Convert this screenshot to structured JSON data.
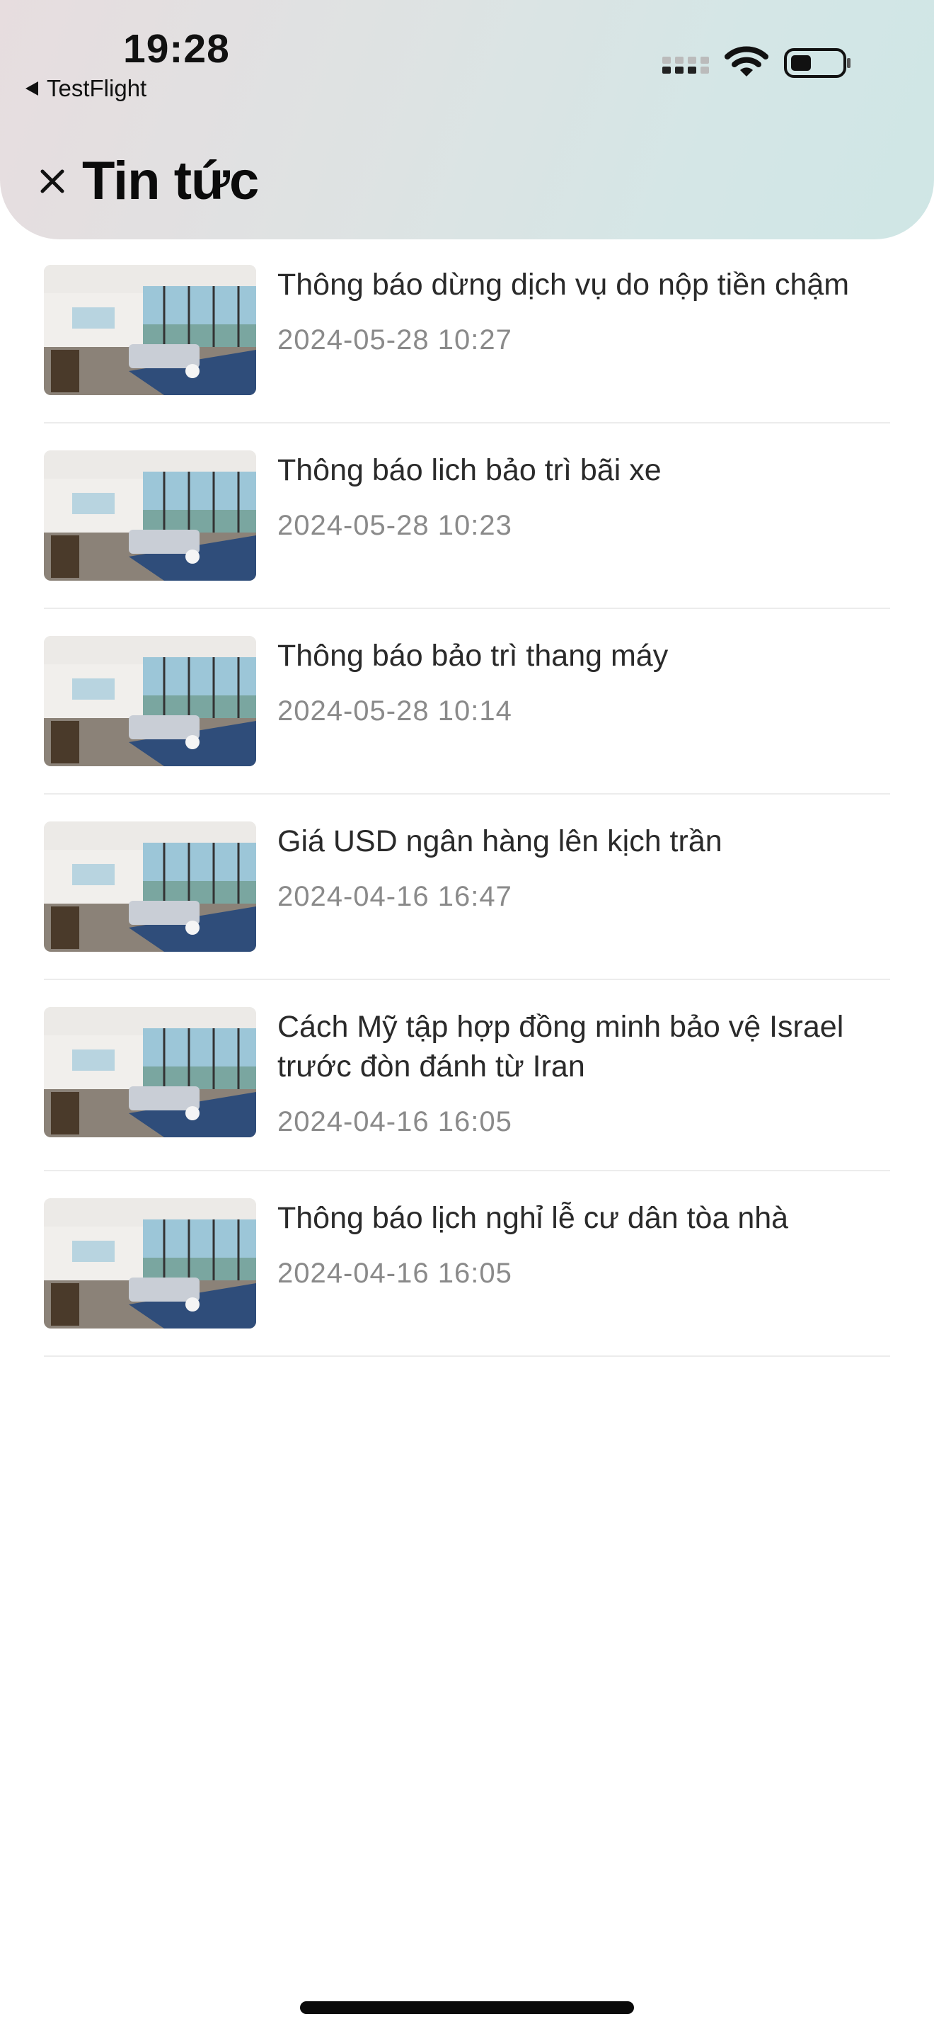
{
  "status_bar": {
    "time": "19:28",
    "back_app": "TestFlight",
    "icons": [
      "cellular-signal-icon",
      "wifi-icon",
      "battery-icon"
    ]
  },
  "header": {
    "title": "Tin tức",
    "close_icon": "close-icon"
  },
  "news": [
    {
      "title": "Thông báo dừng dịch vụ do nộp tiền chậm",
      "date": "2024-05-28 10:27"
    },
    {
      "title": "Thông báo lich bảo trì bãi xe",
      "date": "2024-05-28 10:23"
    },
    {
      "title": "Thông báo bảo trì thang máy",
      "date": "2024-05-28 10:14"
    },
    {
      "title": "Giá USD ngân hàng lên kịch trần",
      "date": "2024-04-16 16:47"
    },
    {
      "title": "Cách Mỹ tập hợp đồng minh bảo vệ Israel trước đòn đánh từ Iran",
      "date": "2024-04-16 16:05"
    },
    {
      "title": "Thông báo lịch nghỉ lễ cư dân tòa nhà",
      "date": "2024-04-16 16:05"
    }
  ],
  "colors": {
    "title_text": "#2a2a2a",
    "date_text": "#8a8a8a",
    "divider": "#ececec"
  }
}
